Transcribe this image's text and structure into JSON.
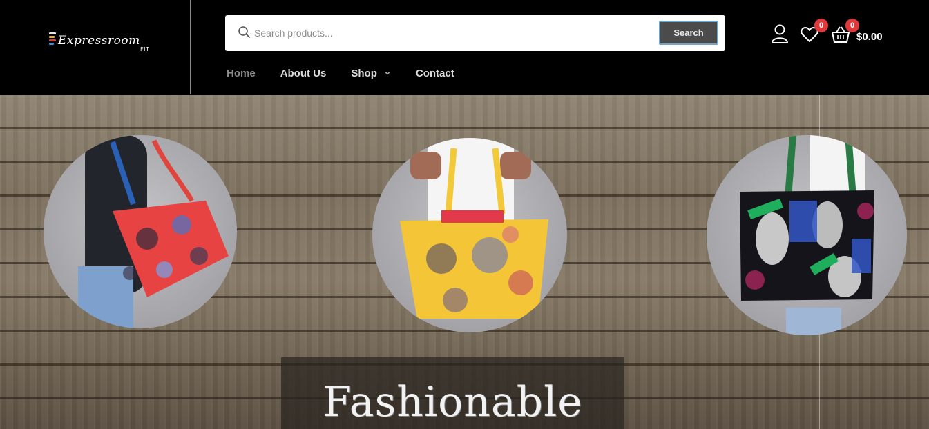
{
  "logo": {
    "wordmark": "Expressroom",
    "sub": "FIT"
  },
  "search": {
    "placeholder": "Search products...",
    "button_label": "Search"
  },
  "nav": {
    "items": [
      {
        "label": "Home"
      },
      {
        "label": "About Us"
      },
      {
        "label": "Shop"
      },
      {
        "label": "Contact"
      }
    ]
  },
  "header_icons": {
    "account": "user-icon",
    "wishlist": "heart-icon",
    "cart": "basket-icon",
    "wishlist_count": "0",
    "cart_count": "0",
    "cart_total": "$0.00"
  },
  "hero": {
    "caption": "Fashionable",
    "products": [
      {
        "image": "red-print-tote-bag"
      },
      {
        "image": "yellow-print-tote-bag"
      },
      {
        "image": "black-pineapple-print-tote-bag"
      }
    ]
  },
  "colors": {
    "header_bg": "#000000",
    "badge": "#e0393b",
    "search_button": "#4b4b4b",
    "nav_active": "#8a8a8a"
  }
}
